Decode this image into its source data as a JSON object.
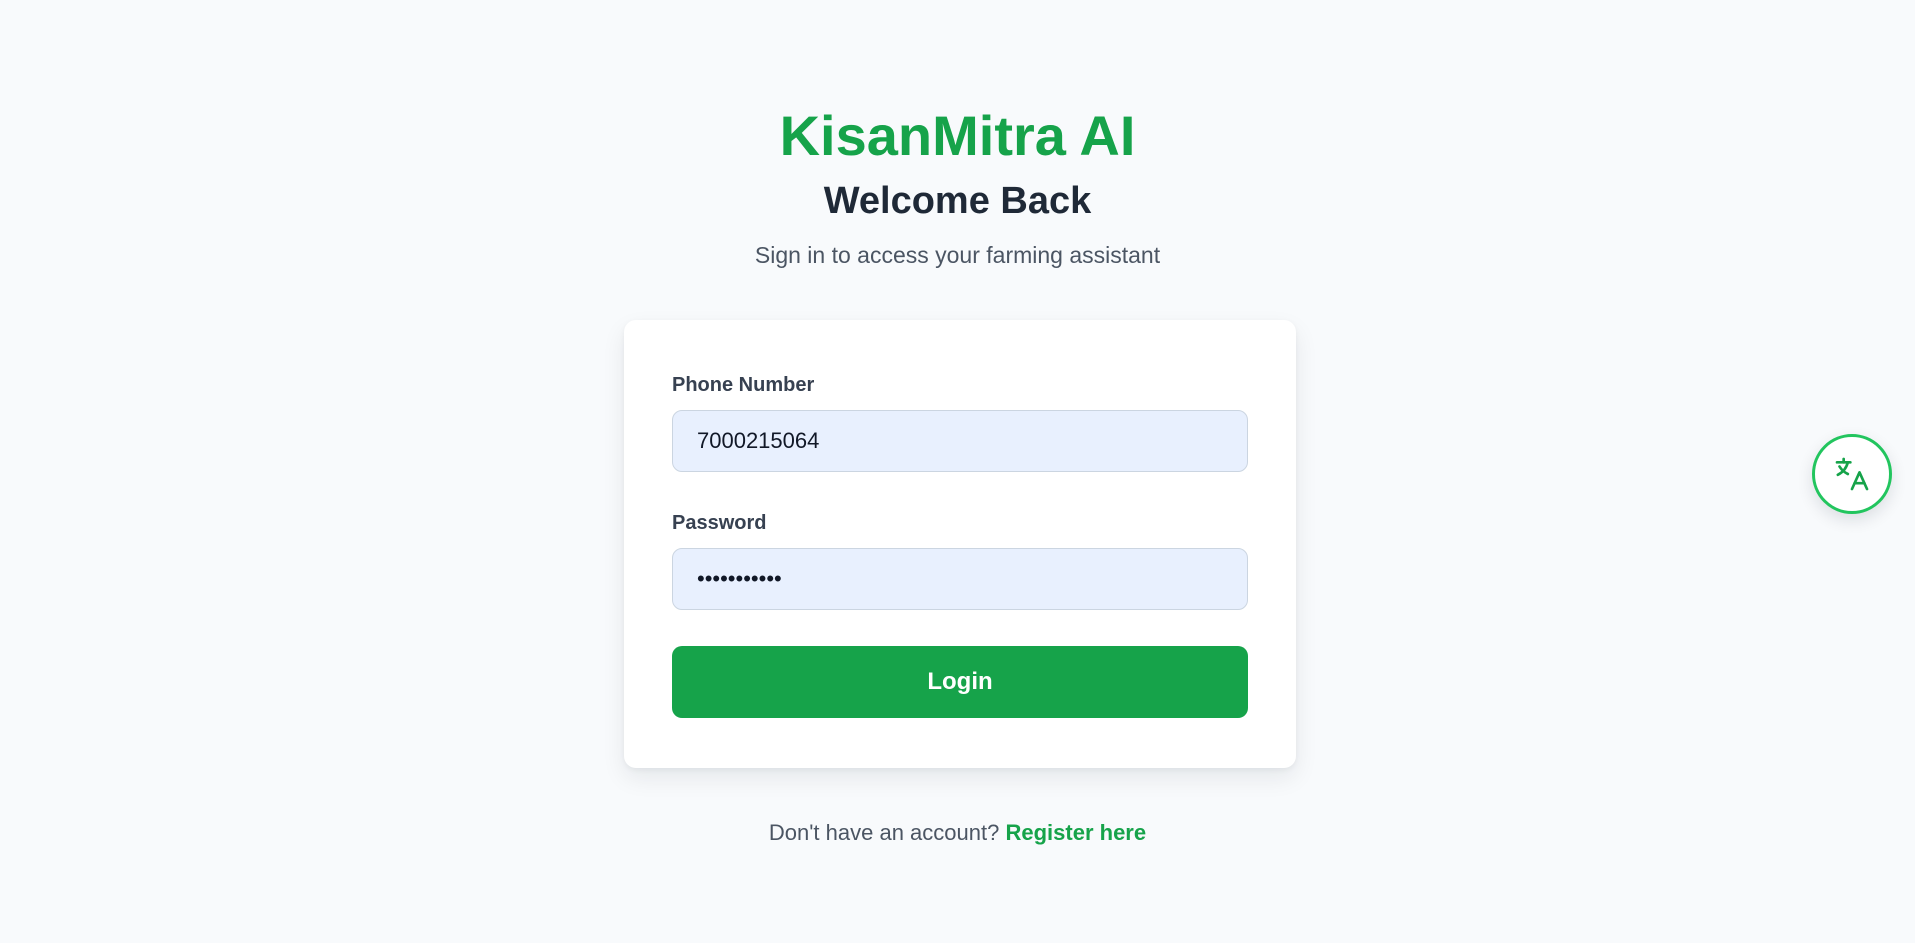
{
  "brand": {
    "name": "KisanMitra AI",
    "color": "#16a34a"
  },
  "header": {
    "title": "Welcome Back",
    "subtitle": "Sign in to access your farming assistant"
  },
  "form": {
    "phone": {
      "label": "Phone Number",
      "value": "7000215064"
    },
    "password": {
      "label": "Password",
      "value": "pppppppppp0"
    },
    "login_label": "Login"
  },
  "footer": {
    "prompt": "Don't have an account?",
    "register_label": "Register here"
  },
  "floating": {
    "translate_icon": "translate-icon"
  }
}
